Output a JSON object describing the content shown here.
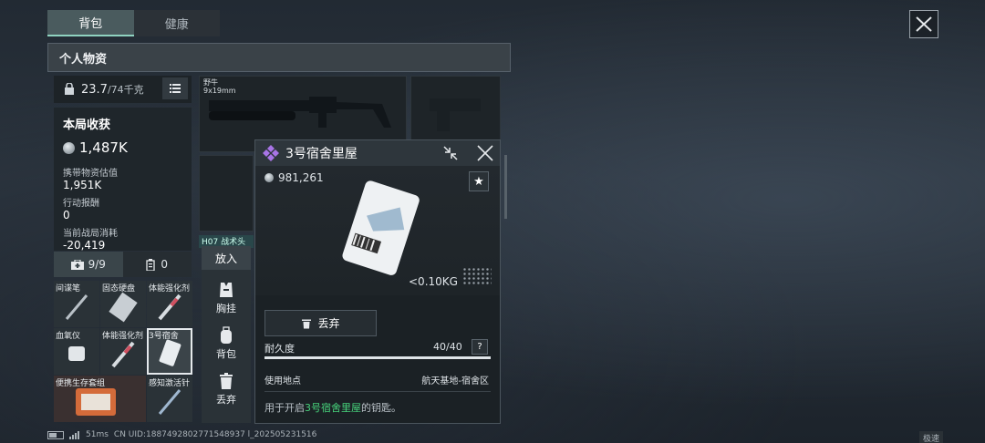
{
  "tabs": [
    {
      "label": "背包",
      "active": true
    },
    {
      "label": "健康",
      "active": false
    }
  ],
  "panel": {
    "title": "个人物资",
    "weight_current": "23.7",
    "weight_max": "/74千克"
  },
  "stats": {
    "title": "本局收获",
    "earnings": "1,487K",
    "carried_label": "携带物资估值",
    "carried_value": "1,951K",
    "reward_label": "行动报酬",
    "reward_value": "0",
    "cost_label": "当前战局消耗",
    "cost_value": "-20,419"
  },
  "capacity": {
    "kit_count": "9/9",
    "case_count": "0"
  },
  "inventory": [
    {
      "label": "间谍笔"
    },
    {
      "label": "固态硬盘"
    },
    {
      "label": "体能强化剂"
    },
    {
      "label": "血氧仪"
    },
    {
      "label": "体能强化剂"
    },
    {
      "label": "3号宿舍"
    },
    {
      "label": "便携生存套组"
    },
    {
      "label": "感知激活针"
    }
  ],
  "weapon": {
    "name": "野牛",
    "caliber": "9x19mm"
  },
  "helmet_label": "H07 战术头盔",
  "actions": {
    "header": "放入",
    "items": [
      {
        "label": "胸挂",
        "icon": "vest-icon"
      },
      {
        "label": "背包",
        "icon": "backpack-icon"
      },
      {
        "label": "丢弃",
        "icon": "trash-icon"
      }
    ]
  },
  "item_detail": {
    "name": "3号宿舍里屋",
    "price": "981,261",
    "weight": "<0.10KG",
    "discard_label": "丢弃",
    "durability_label": "耐久度",
    "durability_value": "40/40",
    "durability_fraction": 1.0,
    "help_label": "?",
    "location_label": "使用地点",
    "location_value": "航天基地-宿舍区",
    "desc_prefix": "用于开启",
    "desc_highlight": "3号宿舍里屋",
    "desc_suffix": "的钥匙。",
    "rarity_color": "#a874e6",
    "highlight_color": "#47d27b"
  },
  "footer": {
    "ping": "51ms",
    "uid": "CN UID:1887492802771548937 l_202505231516",
    "speed_tag": "极速"
  }
}
